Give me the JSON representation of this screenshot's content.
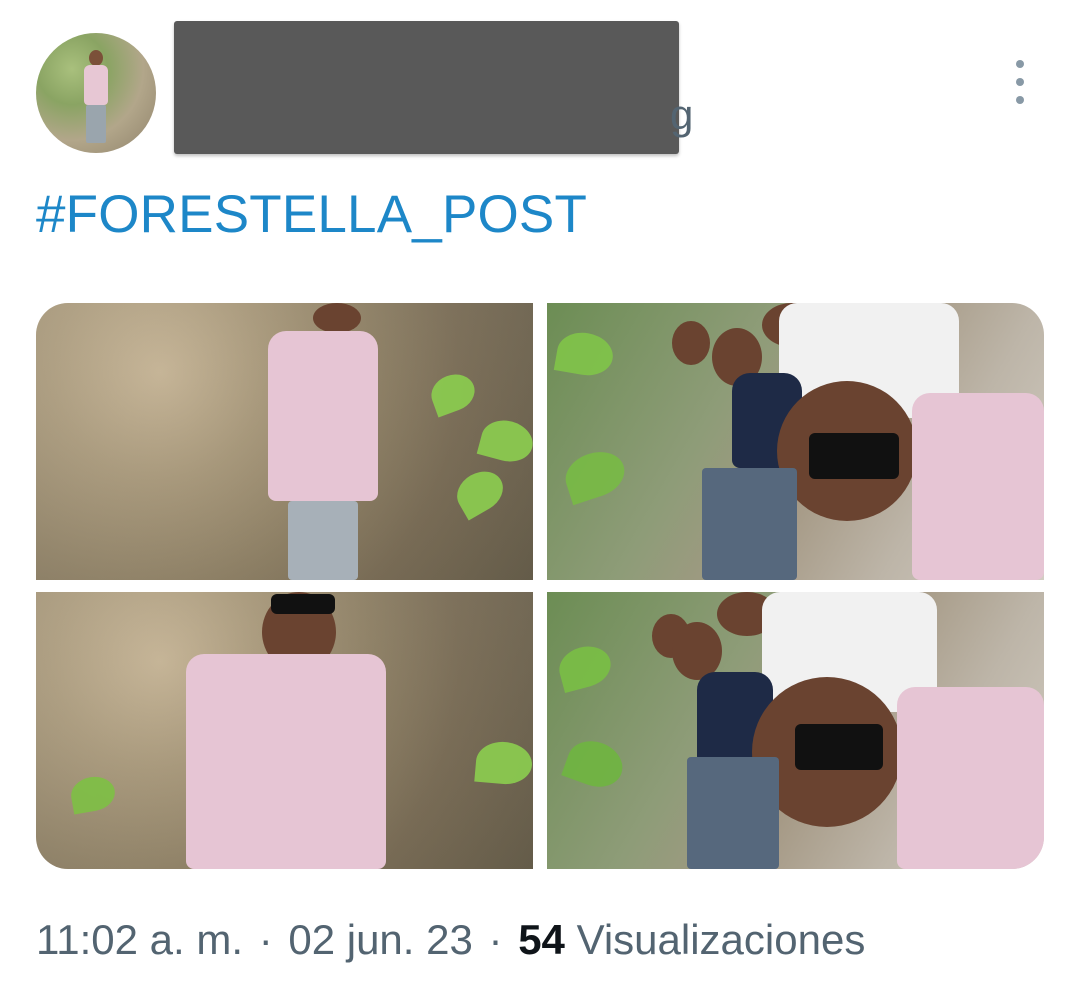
{
  "post": {
    "hashtag": "#FORESTELLA_POST",
    "time": "11:02 a. m.",
    "separator": "·",
    "date": "02 jun. 23",
    "views_count": "54",
    "views_label": "Visualizaciones",
    "redacted_tail": "g"
  },
  "icons": {
    "more": "more-vertical-icon"
  },
  "colors": {
    "hashtag": "#1d87c8",
    "meta_text": "#536471",
    "redaction": "#595959"
  }
}
